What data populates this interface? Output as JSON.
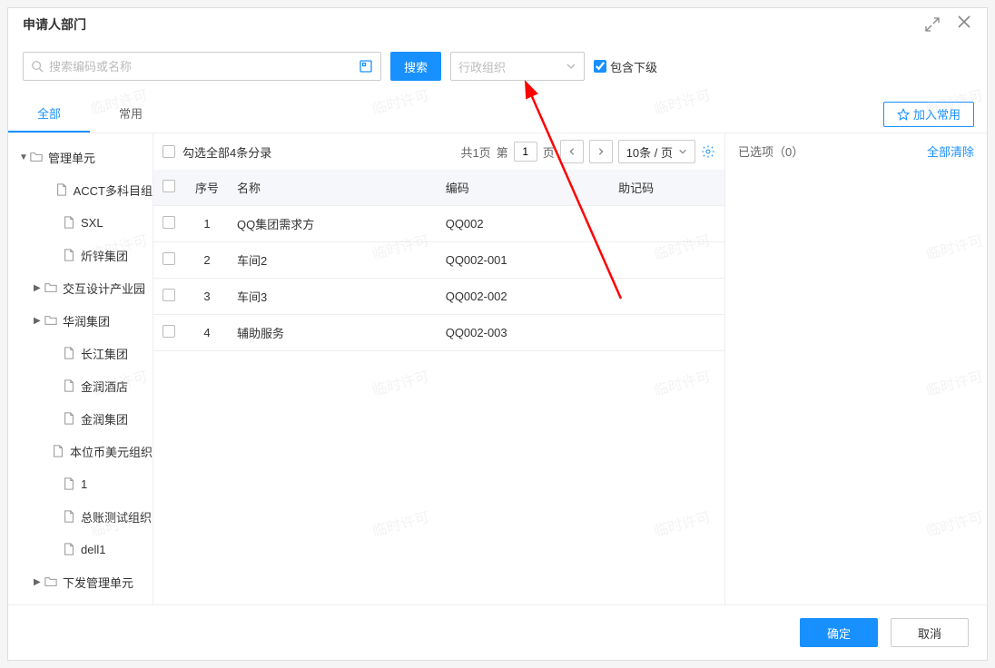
{
  "header": {
    "title": "申请人部门"
  },
  "search": {
    "placeholder": "搜索编码或名称",
    "value": "",
    "button_label": "搜索",
    "select_value": "行政组织",
    "checkbox_label": "包含下级",
    "checkbox_checked": true
  },
  "tabs": {
    "all": "全部",
    "common": "常用",
    "add_common": "加入常用"
  },
  "tree": {
    "root": "管理单元",
    "nodes": [
      {
        "label": "ACCT多科目组",
        "type": "file",
        "indent": 2
      },
      {
        "label": "SXL",
        "type": "file",
        "indent": 2
      },
      {
        "label": "炘锌集团",
        "type": "file",
        "indent": 2
      },
      {
        "label": "交互设计产业园",
        "type": "folder",
        "indent": 1
      },
      {
        "label": "华润集团",
        "type": "folder",
        "indent": 1
      },
      {
        "label": "长江集团",
        "type": "file",
        "indent": 2
      },
      {
        "label": "金润酒店",
        "type": "file",
        "indent": 2
      },
      {
        "label": "金润集团",
        "type": "file",
        "indent": 2
      },
      {
        "label": "本位币美元组织",
        "type": "file",
        "indent": 2
      },
      {
        "label": "1",
        "type": "file",
        "indent": 2
      },
      {
        "label": "总账测试组织",
        "type": "file",
        "indent": 2
      },
      {
        "label": "dell1",
        "type": "file",
        "indent": 2
      },
      {
        "label": "下发管理单元",
        "type": "folder",
        "indent": 1
      }
    ]
  },
  "table": {
    "select_all_label": "勾选全部4条分录",
    "pagination": {
      "total_pages_label": "共1页",
      "page_no_prefix": "第",
      "page_no_suffix": "页",
      "page_value": "1",
      "page_size_label": "10条 / 页"
    },
    "columns": {
      "seq": "序号",
      "name": "名称",
      "code": "编码",
      "mnemonic": "助记码"
    },
    "rows": [
      {
        "seq": "1",
        "name": "QQ集团需求方",
        "code": "QQ002",
        "mnemonic": ""
      },
      {
        "seq": "2",
        "name": "车间2",
        "code": "QQ002-001",
        "mnemonic": ""
      },
      {
        "seq": "3",
        "name": "车间3",
        "code": "QQ002-002",
        "mnemonic": ""
      },
      {
        "seq": "4",
        "name": "辅助服务",
        "code": "QQ002-003",
        "mnemonic": ""
      }
    ]
  },
  "selected": {
    "label": "已选项（0）",
    "clear_label": "全部清除"
  },
  "footer": {
    "ok": "确定",
    "cancel": "取消"
  },
  "watermark": "临时许可"
}
